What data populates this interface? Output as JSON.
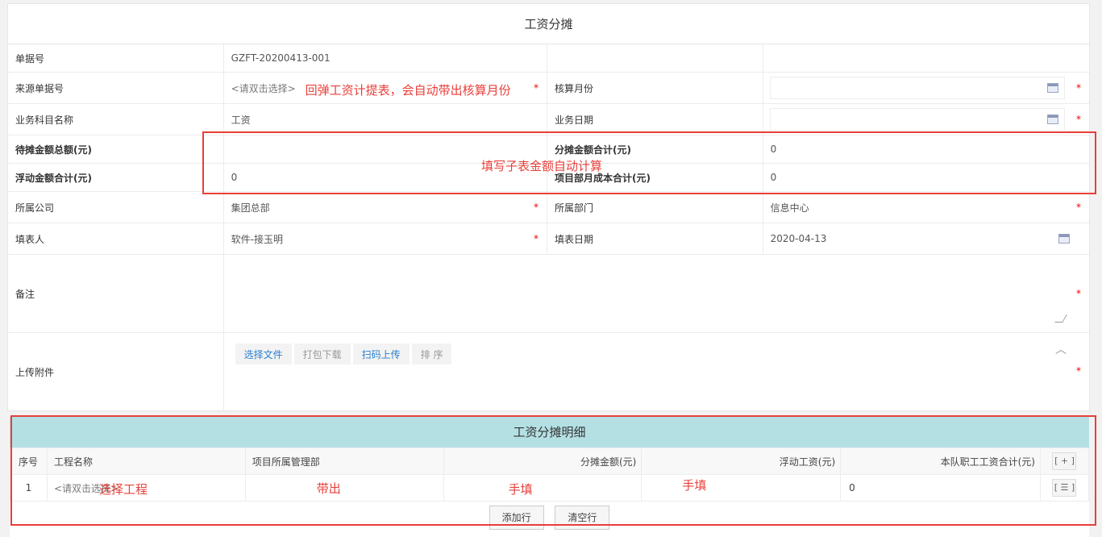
{
  "form": {
    "title": "工资分摊",
    "bill_no_label": "单据号",
    "bill_no_value": "GZFT-20200413-001",
    "source_label": "来源单据号",
    "source_placeholder": "<请双击选择>",
    "source_note": "回弹工资计提表，会自动带出核算月份",
    "account_month_label": "核算月份",
    "subject_label": "业务科目名称",
    "subject_value": "工资",
    "biz_date_label": "业务日期",
    "pending_total_label": "待摊金额总额(元)",
    "allocated_total_label": "分摊金额合计(元)",
    "allocated_total_value": "0",
    "float_total_label": "浮动金额合计(元)",
    "float_total_value": "0",
    "project_cost_label": "项目部月成本合计(元)",
    "project_cost_value": "0",
    "amount_note": "填写子表金额自动计算",
    "company_label": "所属公司",
    "company_value": "集团总部",
    "dept_label": "所属部门",
    "dept_value": "信息中心",
    "filler_label": "填表人",
    "filler_value": "软件-接玉明",
    "fill_date_label": "填表日期",
    "fill_date_value": "2020-04-13",
    "remark_label": "备注",
    "attach_label": "上传附件",
    "btn_select_file": "选择文件",
    "btn_pack_download": "打包下载",
    "btn_scan_upload": "扫码上传",
    "btn_sort": "排 序",
    "required_mark": "*"
  },
  "detail": {
    "title": "工资分摊明细",
    "columns": [
      "序号",
      "工程名称",
      "项目所属管理部",
      "分摊金额(元)",
      "浮动工资(元)",
      "本队职工工资合计(元)"
    ],
    "add_icon_label": "[ + ]",
    "row": {
      "index": "1",
      "project_placeholder": "<请双击选择>",
      "total": "0",
      "menu_icon_label": "[ ☰ ]"
    },
    "notes": {
      "project": "选择工程",
      "dept": "带出",
      "amount": "手填",
      "float": "手填"
    },
    "add_row_button": "添加行",
    "clear_row_button": "清空行"
  },
  "colors": {
    "annotation_red": "#e83f3a",
    "detail_header": "#b4e0e4",
    "link_blue": "#2b7fcf"
  }
}
